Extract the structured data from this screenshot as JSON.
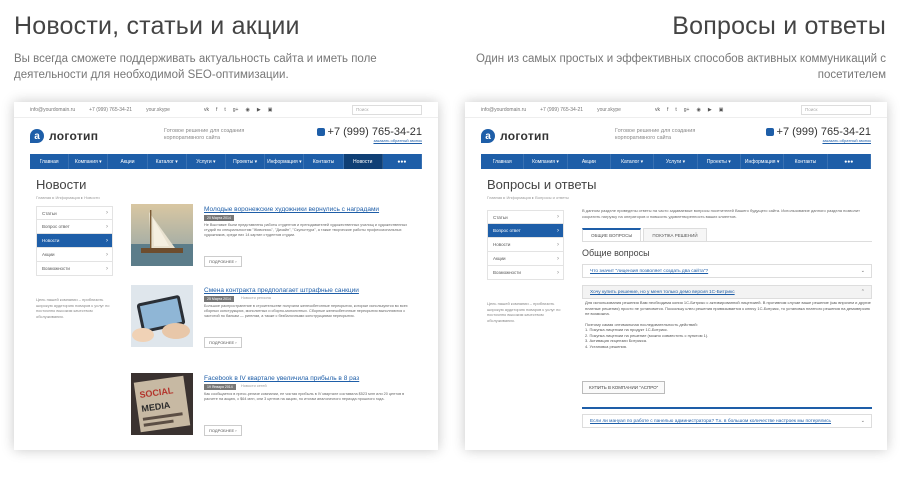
{
  "left": {
    "title": "Новости, статьи и акции",
    "subtitle": "Вы всегда сможете поддерживать актуальность сайта и иметь поле деятельности для необходимой SEO-оптимизации."
  },
  "right": {
    "title": "Вопросы и ответы",
    "subtitle": "Один из самых простых и эффективных способов активных коммуникаций с посетителем"
  },
  "site": {
    "email": "info@yourdomain.ru",
    "topphone": "+7 (999) 765-34-21",
    "skype": "your.skype",
    "social": [
      "vk",
      "f",
      "t",
      "g+",
      "◉",
      "▶",
      "▣"
    ],
    "search_placeholder": "Поиск",
    "logo_letter": "а",
    "logo_text": "логотип",
    "slogan": "Готовое решение для создания корпоративного сайта",
    "phone": "+7 (999) 765-34-21",
    "callback": "заказать обратный звонок",
    "nav": [
      "Главная",
      "Компания ▾",
      "Акции",
      "Каталог ▾",
      "Услуги ▾",
      "Проекты ▾",
      "Информация ▾",
      "Контакты",
      "Новости",
      "●●●"
    ],
    "nav_right": [
      "Главная",
      "Компания ▾",
      "Акции",
      "Каталог ▾",
      "Услуги ▾",
      "Проекты ▾",
      "Информация ▾",
      "Контакты",
      "●●●"
    ],
    "side": [
      "Статьи",
      "Вопрос ответ",
      "Новости",
      "Акции",
      "Возможности"
    ],
    "side_note": "Цель нашей компании – приблизить широкую аудиторию поваров к услуг по постоянно высоким качеством обслуживания."
  },
  "news_page": {
    "title": "Новости",
    "crumbs": "Главная ▸ Информация ▸ Новости",
    "items": [
      {
        "title": "Молодые воронежские художники вернулись с наградами",
        "date": "20 Марта 2014",
        "tag": "",
        "text": "Не Выставке были представлены работы студентов и преподавателей художественных училищ и художественных студий по специальностям \"Живопись\", \"Дизайн\", \"Скульптура\", а также творческие работы профессиональных художников, среди них 14 картин студентов студии.",
        "more": "ПОДРОБНЕЕ ›"
      },
      {
        "title": "Смена контракта предполагает штрафные санкции",
        "date": "25 Марта 2014",
        "tag": "Новости региона",
        "text": "Большое распространение в строительстве получили железобетонные перекрытия, которые используются во всех сборных конструкциях, монолитных и сборно-монолитных. Сборные железобетонные перекрытия выполняются с частотой по балкам — ригелям, а также с безбалочными конструкциями перекрытия.",
        "more": "ПОДРОБНЕЕ ›"
      },
      {
        "title": "Facebook в IV квартале увеличила прибыль в 8 раз",
        "date": "19 Января 2014",
        "tag": "Новости сетей",
        "text": "Как сообщается в пресс-релизе компании, ее чистая прибыль в IV квартале составила $523 млн или 20 центов в расчете на акцию, с $64 млн, или 3 центов на акцию, по итогам аналогичного периода прошлого года.",
        "more": "ПОДРОБНЕЕ ›"
      }
    ]
  },
  "faq_page": {
    "title": "Вопросы и ответы",
    "crumbs": "Главная ▸ Информация ▸ Вопросы и ответы",
    "intro": "В данном разделе приведены ответы на часто задаваемые вопросы посетителей Вашего будущего сайта. Использование данного раздела позволит сократить нагрузку на операторов и повысить удовлетворенность ваших клиентов.",
    "tabs": [
      "ОБЩИЕ ВОПРОСЫ",
      "ПОКУПКА РЕШЕНИЙ"
    ],
    "section": "Общие вопросы",
    "q1": "Что значит \"лицензия позволяет создать два сайта\"?",
    "q2": "Хочу купить решение, но у меня только демо версия 1С-Битрикс",
    "answer": [
      "Для использования решения Вам необходима копия 1С-Битрикс с активированной лицензией. В противном случае ваше решение (как впрочем и другие платные решения) просто не установится. Поскольку ключ решения привязывается к ключу 1С-Битрикс, то установка платного решения на демоверсию не возможна.",
      "Поэтому самая оптимальная последовательность действий:",
      "1. Покупка лицензии на продукт 1С-Битрикс.",
      "2. Покупка лицензии на решение (можно совместить с пунктом 1).",
      "3. Активация лицензии Битрикса.",
      "4. Установка решения."
    ],
    "buy": "КУПИТЬ В КОМПАНИИ \"АСПРО\"",
    "q3": "Если ли мануал по работе с панелью администратора? Т.к. в большом количестве настроек мы потерялись"
  }
}
